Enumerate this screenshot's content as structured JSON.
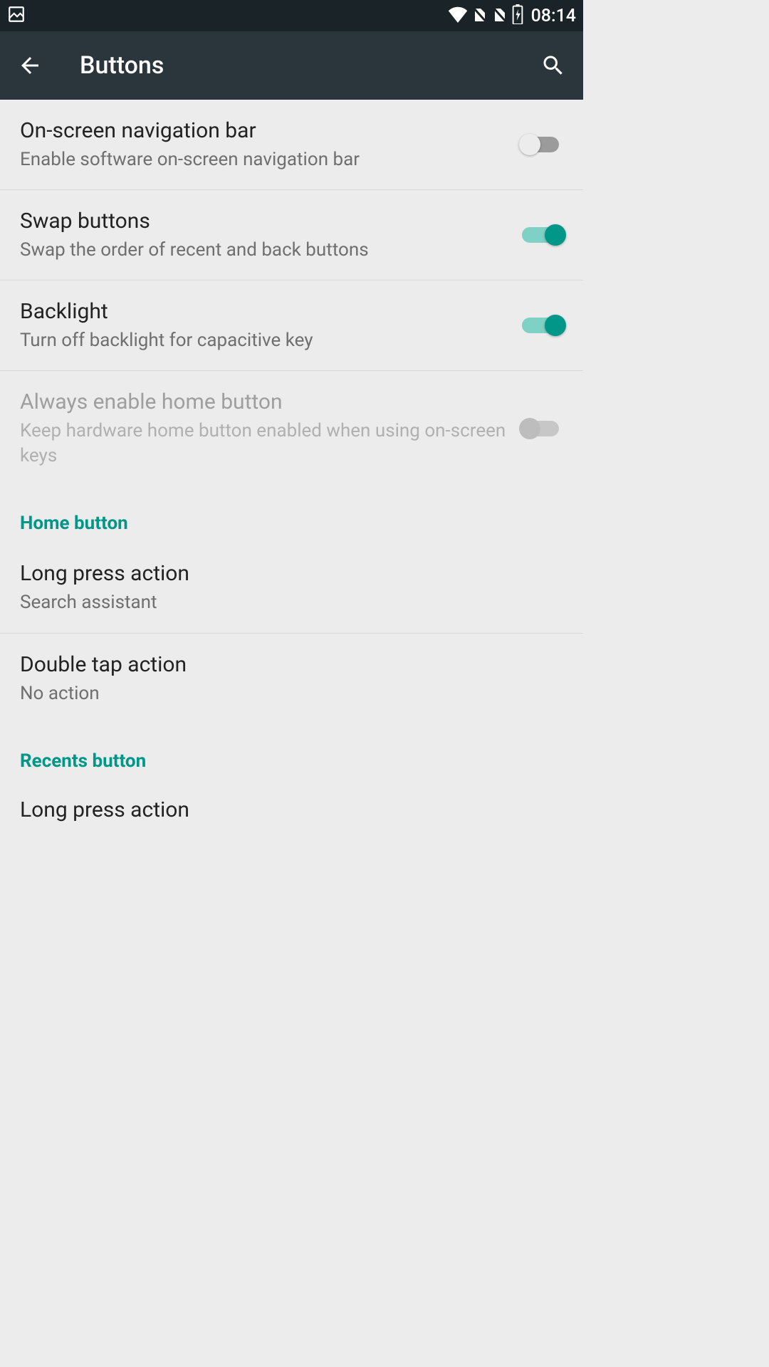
{
  "statusbar": {
    "time": "08:14"
  },
  "appbar": {
    "title": "Buttons"
  },
  "settings": {
    "onscreen_nav": {
      "title": "On-screen navigation bar",
      "subtitle": "Enable software on-screen navigation bar"
    },
    "swap_buttons": {
      "title": "Swap buttons",
      "subtitle": "Swap the order of recent and back buttons"
    },
    "backlight": {
      "title": "Backlight",
      "subtitle": "Turn off backlight for capacitive key"
    },
    "always_home": {
      "title": "Always enable home button",
      "subtitle": "Keep hardware home button enabled when using on-screen keys"
    }
  },
  "sections": {
    "home_button": "Home button",
    "recents_button": "Recents button"
  },
  "home_actions": {
    "long_press": {
      "title": "Long press action",
      "value": "Search assistant"
    },
    "double_tap": {
      "title": "Double tap action",
      "value": "No action"
    }
  },
  "recents_actions": {
    "long_press_title": "Long press action"
  }
}
